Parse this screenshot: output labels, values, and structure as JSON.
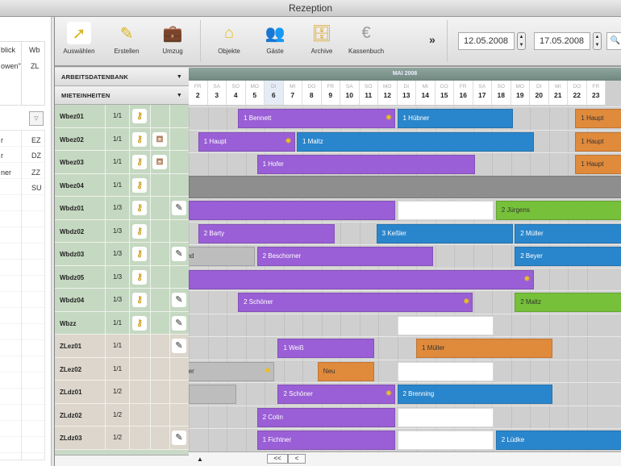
{
  "window": {
    "title": "Rezeption"
  },
  "left_panel": {
    "header": [
      "blick",
      "Wb"
    ],
    "row1": [
      "owen\"",
      "ZL"
    ],
    "types": [
      "EZ",
      "DZ",
      "ZZ",
      "SU"
    ],
    "names": [
      "r",
      "r",
      "ner"
    ]
  },
  "toolbar": {
    "buttons": [
      {
        "label": "Auswählen",
        "icon": "cursor-icon"
      },
      {
        "label": "Erstellen",
        "icon": "pencil-icon"
      },
      {
        "label": "Umzug",
        "icon": "suitcase-icon"
      },
      {
        "label": "Objekte",
        "icon": "house-icon"
      },
      {
        "label": "Gäste",
        "icon": "guests-icon"
      },
      {
        "label": "Archive",
        "icon": "archive-icon"
      },
      {
        "label": "Kassenbuch",
        "icon": "cashbook-icon"
      }
    ],
    "more": "»",
    "date_from": "12.05.2008",
    "date_to": "17.05.2008",
    "search": "🔍"
  },
  "sidebar": {
    "section1": "ARBEITSDATENBANK",
    "section2": "MIETEINHEITEN",
    "units": [
      {
        "name": "Wbez01",
        "ratio": "1/1",
        "keys": true,
        "bed": false,
        "edit": false,
        "group": "wb"
      },
      {
        "name": "Wbez02",
        "ratio": "1/1",
        "keys": true,
        "bed": true,
        "edit": false,
        "group": "wb"
      },
      {
        "name": "Wbez03",
        "ratio": "1/1",
        "keys": true,
        "bed": true,
        "edit": false,
        "group": "wb"
      },
      {
        "name": "Wbez04",
        "ratio": "1/1",
        "keys": true,
        "bed": false,
        "edit": false,
        "group": "wb"
      },
      {
        "name": "Wbdz01",
        "ratio": "1/3",
        "keys": true,
        "bed": false,
        "edit": true,
        "group": "wb"
      },
      {
        "name": "Wbdz02",
        "ratio": "1/3",
        "keys": true,
        "bed": false,
        "edit": false,
        "group": "wb"
      },
      {
        "name": "Wbdz03",
        "ratio": "1/3",
        "keys": true,
        "bed": false,
        "edit": true,
        "group": "wb"
      },
      {
        "name": "Wbdz05",
        "ratio": "1/3",
        "keys": true,
        "bed": false,
        "edit": false,
        "group": "wb"
      },
      {
        "name": "Wbdz04",
        "ratio": "1/3",
        "keys": true,
        "bed": false,
        "edit": true,
        "group": "wb"
      },
      {
        "name": "Wbzz",
        "ratio": "1/1",
        "keys": true,
        "bed": false,
        "edit": true,
        "group": "wb"
      },
      {
        "name": "ZLez01",
        "ratio": "1/1",
        "keys": false,
        "bed": false,
        "edit": true,
        "group": "zl"
      },
      {
        "name": "ZLez02",
        "ratio": "1/1",
        "keys": false,
        "bed": false,
        "edit": false,
        "group": "zl"
      },
      {
        "name": "ZLdz01",
        "ratio": "1/2",
        "keys": false,
        "bed": false,
        "edit": false,
        "group": "zl"
      },
      {
        "name": "ZLdz02",
        "ratio": "1/2",
        "keys": false,
        "bed": false,
        "edit": false,
        "group": "zl"
      },
      {
        "name": "ZLdz03",
        "ratio": "1/2",
        "keys": false,
        "bed": false,
        "edit": true,
        "group": "zl"
      }
    ]
  },
  "calendar": {
    "month": "MAI 2008",
    "today": 6,
    "days": [
      {
        "d": "2",
        "w": "FR"
      },
      {
        "d": "3",
        "w": "SA"
      },
      {
        "d": "4",
        "w": "SO"
      },
      {
        "d": "5",
        "w": "MO"
      },
      {
        "d": "6",
        "w": "DI"
      },
      {
        "d": "7",
        "w": "MI"
      },
      {
        "d": "8",
        "w": "DO"
      },
      {
        "d": "9",
        "w": "FR"
      },
      {
        "d": "10",
        "w": "SA"
      },
      {
        "d": "11",
        "w": "SO"
      },
      {
        "d": "12",
        "w": "MO"
      },
      {
        "d": "13",
        "w": "DI"
      },
      {
        "d": "14",
        "w": "MI"
      },
      {
        "d": "15",
        "w": "DO"
      },
      {
        "d": "16",
        "w": "FR"
      },
      {
        "d": "17",
        "w": "SA"
      },
      {
        "d": "18",
        "w": "SO"
      },
      {
        "d": "19",
        "w": "MO"
      },
      {
        "d": "20",
        "w": "DI"
      },
      {
        "d": "21",
        "w": "MI"
      },
      {
        "d": "22",
        "w": "DO"
      },
      {
        "d": "23",
        "w": "FR"
      }
    ]
  },
  "colors": {
    "purple": "#9a5fd6",
    "blue": "#2a86cc",
    "orange": "#e08a3c",
    "green": "#76c03a",
    "gray": "#bdbdbd",
    "white": "#ffffff",
    "dark": "#8e8e8e"
  },
  "bookings": [
    {
      "row": 0,
      "start": 4.6,
      "end": 12.9,
      "color": "purple",
      "label": "1 Bennett",
      "star": true
    },
    {
      "row": 0,
      "start": 13,
      "end": 19.1,
      "color": "blue",
      "label": "1 Hübner"
    },
    {
      "row": 0,
      "start": 22.4,
      "end": 25,
      "color": "orange",
      "label": "1 Haupt",
      "dark": true
    },
    {
      "row": 1,
      "start": 2.5,
      "end": 7.6,
      "color": "purple",
      "label": "1 Haupt",
      "star": true
    },
    {
      "row": 1,
      "start": 7.7,
      "end": 20.2,
      "color": "blue",
      "label": "1 Maltz"
    },
    {
      "row": 1,
      "start": 22.4,
      "end": 25,
      "color": "orange",
      "label": "1 Haupt",
      "dark": true
    },
    {
      "row": 2,
      "start": 5.6,
      "end": 17.1,
      "color": "purple",
      "label": "1 Hofer"
    },
    {
      "row": 2,
      "start": 22.4,
      "end": 25,
      "color": "orange",
      "label": "1 Haupt",
      "dark": true
    },
    {
      "row": 3,
      "start": 2,
      "end": 25,
      "color": "dark",
      "label": ""
    },
    {
      "row": 4,
      "start": 2,
      "end": 12.9,
      "color": "purple",
      "label": ""
    },
    {
      "row": 4,
      "start": 13,
      "end": 18.1,
      "color": "white",
      "label": ""
    },
    {
      "row": 4,
      "start": 18.2,
      "end": 25,
      "color": "green",
      "label": "2 Jürgens",
      "dark": true
    },
    {
      "row": 5,
      "start": 2.5,
      "end": 9.7,
      "color": "purple",
      "label": "2 Barty"
    },
    {
      "row": 5,
      "start": 11.9,
      "end": 19.1,
      "color": "blue",
      "label": "3 Keßler"
    },
    {
      "row": 5,
      "start": 19.2,
      "end": 25,
      "color": "blue",
      "label": "2 Müller"
    },
    {
      "row": 6,
      "start": 1.6,
      "end": 5.5,
      "color": "gray",
      "label": "nd",
      "dark": true
    },
    {
      "row": 6,
      "start": 5.6,
      "end": 14.9,
      "color": "purple",
      "label": "2 Beschorner"
    },
    {
      "row": 6,
      "start": 19.2,
      "end": 25,
      "color": "blue",
      "label": "2 Beyer"
    },
    {
      "row": 7,
      "start": 2,
      "end": 20.2,
      "color": "purple",
      "label": "",
      "star": true
    },
    {
      "row": 8,
      "start": 4.6,
      "end": 17,
      "color": "purple",
      "label": "2 Schöner",
      "star": true
    },
    {
      "row": 8,
      "start": 19.2,
      "end": 25,
      "color": "green",
      "label": "2 Maltz",
      "dark": true
    },
    {
      "row": 9,
      "start": 13,
      "end": 18.1,
      "color": "white",
      "label": ""
    },
    {
      "row": 10,
      "start": 6.7,
      "end": 11.8,
      "color": "purple",
      "label": "1 Weiß"
    },
    {
      "row": 10,
      "start": 14,
      "end": 21.2,
      "color": "orange",
      "label": "1 Müller",
      "dark": true
    },
    {
      "row": 11,
      "start": 1.5,
      "end": 6.5,
      "color": "gray",
      "label": "ner",
      "dark": true,
      "star": true
    },
    {
      "row": 11,
      "start": 8.8,
      "end": 11.8,
      "color": "orange",
      "label": "Neu",
      "dark": true
    },
    {
      "row": 11,
      "start": 13,
      "end": 18.1,
      "color": "white",
      "label": ""
    },
    {
      "row": 12,
      "start": 2,
      "end": 4.5,
      "color": "gray",
      "label": ""
    },
    {
      "row": 12,
      "start": 6.7,
      "end": 12.9,
      "color": "purple",
      "label": "2 Schöner",
      "star": true
    },
    {
      "row": 12,
      "start": 13,
      "end": 21.2,
      "color": "blue",
      "label": "2 Brenning"
    },
    {
      "row": 13,
      "start": 5.6,
      "end": 12.9,
      "color": "purple",
      "label": "2 Cotin"
    },
    {
      "row": 13,
      "start": 13,
      "end": 18.1,
      "color": "white",
      "label": ""
    },
    {
      "row": 14,
      "start": 5.6,
      "end": 12.9,
      "color": "purple",
      "label": "1 Fichtner"
    },
    {
      "row": 14,
      "start": 13,
      "end": 18.1,
      "color": "white",
      "label": ""
    },
    {
      "row": 14,
      "start": 18.2,
      "end": 25,
      "color": "blue",
      "label": "2 Lüdke"
    }
  ],
  "nav": {
    "first": "<<",
    "prev": "<"
  }
}
